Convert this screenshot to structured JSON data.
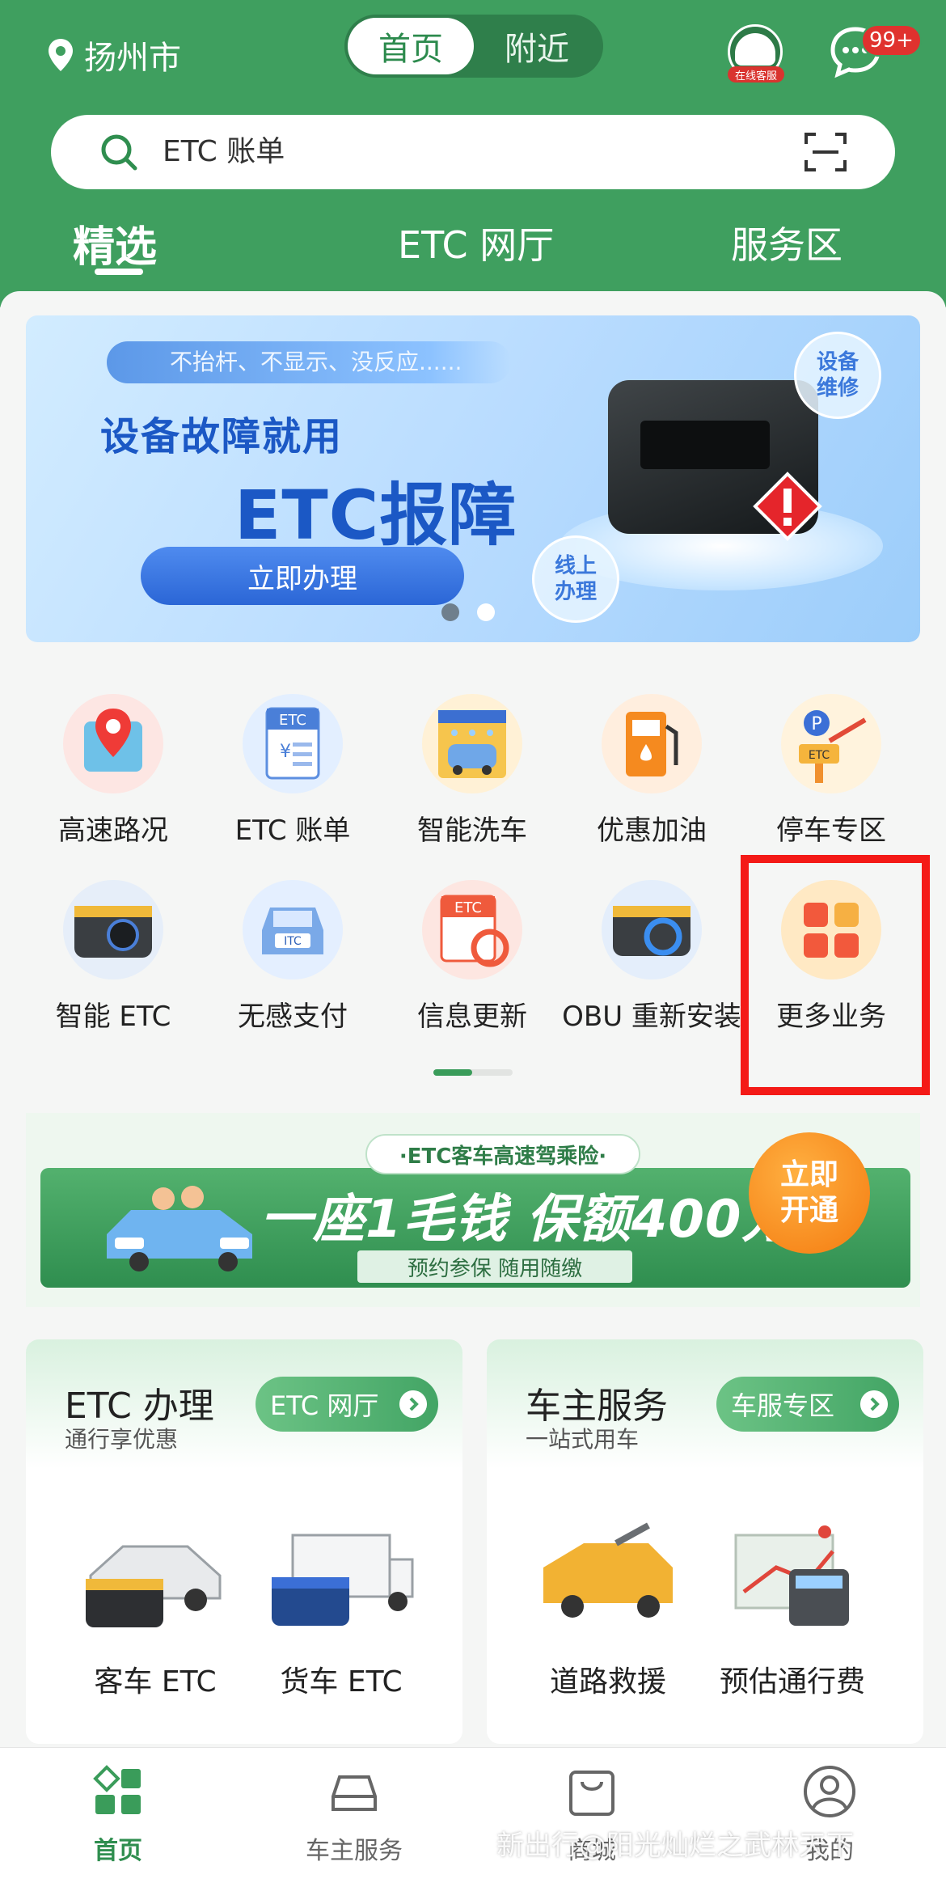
{
  "header": {
    "city": "扬州市",
    "segment": {
      "options": [
        "首页",
        "附近"
      ],
      "active": 0
    },
    "service_tag": "在线客服",
    "message_badge": "99+",
    "search_placeholder": "ETC 账单",
    "tabs": [
      {
        "label": "精选",
        "active": true
      },
      {
        "label": "ETC 网厅",
        "active": false
      },
      {
        "label": "服务区",
        "active": false
      }
    ]
  },
  "banner": {
    "tagline": "不抬杆、不显示、没反应......",
    "headline": "设备故障就用",
    "headline_big": "ETC报障",
    "cta": "立即办理",
    "bubble_top": "设备\n维修",
    "bubble_bottom": "线上\n办理",
    "slides": 2,
    "active_slide": 0
  },
  "services": [
    {
      "label": "高速路况",
      "icon": "map-pin-icon"
    },
    {
      "label": "ETC 账单",
      "icon": "etc-bill-icon"
    },
    {
      "label": "智能洗车",
      "icon": "car-wash-icon"
    },
    {
      "label": "优惠加油",
      "icon": "fuel-pump-icon"
    },
    {
      "label": "停车专区",
      "icon": "parking-icon"
    },
    {
      "label": "智能 ETC",
      "icon": "etc-camera-icon"
    },
    {
      "label": "无感支付",
      "icon": "car-front-icon"
    },
    {
      "label": "信息更新",
      "icon": "etc-refresh-icon"
    },
    {
      "label": "OBU 重新安装",
      "icon": "obu-reinstall-icon"
    },
    {
      "label": "更多业务",
      "icon": "grid-icon"
    }
  ],
  "insurance": {
    "pill": "·ETC客车高速驾乘险·",
    "headline": "一座1毛钱 保额400万",
    "sub": "预约参保 随用随缴",
    "cta": "立即\n开通"
  },
  "cards": [
    {
      "title": "ETC 办理",
      "subtitle": "通行享优惠",
      "button": "ETC 网厅",
      "options": [
        "客车 ETC",
        "货车 ETC"
      ]
    },
    {
      "title": "车主服务",
      "subtitle": "一站式用车",
      "button": "车服专区",
      "options": [
        "道路救援",
        "预估通行费"
      ]
    }
  ],
  "bottom_nav": [
    {
      "label": "首页",
      "icon": "home-grid-icon",
      "active": true
    },
    {
      "label": "车主服务",
      "icon": "car-icon",
      "active": false
    },
    {
      "label": "商城",
      "icon": "shopping-bag-icon",
      "active": false
    },
    {
      "label": "我的",
      "icon": "user-icon",
      "active": false
    }
  ],
  "watermark": "新出行@阳光灿烂之武林天下",
  "colors": {
    "brand": "#3f9f5f",
    "accent_blue": "#1b58c5",
    "highlight": "#f41a17",
    "cta_orange": "#f47b10"
  }
}
